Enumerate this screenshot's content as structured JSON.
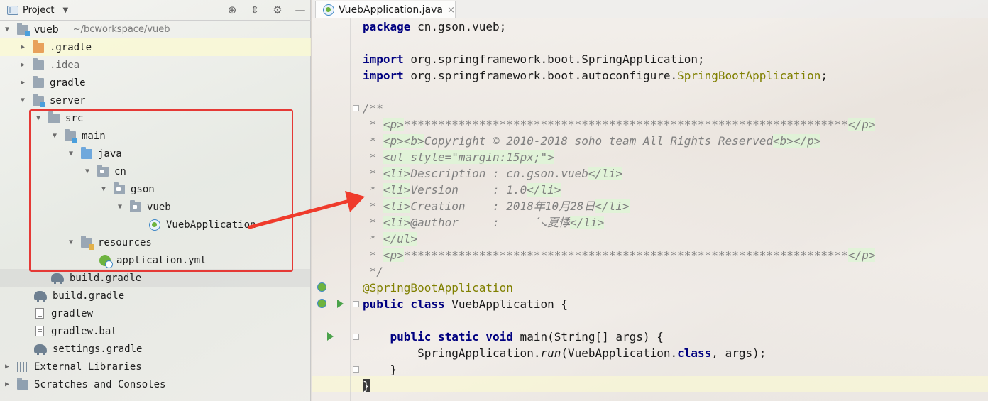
{
  "project_panel": {
    "title": "Project",
    "tools": [
      "target-icon",
      "collapse-icon",
      "gear-icon",
      "minimize-icon"
    ],
    "tree": [
      {
        "label": "vueb",
        "path": "~/bcworkspace/vueb"
      },
      {
        "label": ".gradle"
      },
      {
        "label": ".idea"
      },
      {
        "label": "gradle"
      },
      {
        "label": "server"
      },
      {
        "label": "src"
      },
      {
        "label": "main"
      },
      {
        "label": "java"
      },
      {
        "label": "cn"
      },
      {
        "label": "gson"
      },
      {
        "label": "vueb"
      },
      {
        "label": "VuebApplication"
      },
      {
        "label": "resources"
      },
      {
        "label": "application.yml"
      },
      {
        "label": "build.gradle"
      },
      {
        "label": "build.gradle"
      },
      {
        "label": "gradlew"
      },
      {
        "label": "gradlew.bat"
      },
      {
        "label": "settings.gradle"
      },
      {
        "label": "External Libraries"
      },
      {
        "label": "Scratches and Consoles"
      }
    ]
  },
  "editor": {
    "tab_label": "VuebApplication.java",
    "tab_close": "×",
    "code": {
      "l1_kw": "package",
      "l1_rest": " cn.gson.vueb;",
      "l3_kw": "import",
      "l3_rest": " org.springframework.boot.SpringApplication;",
      "l4_kw": "import",
      "l4_rest": " org.springframework.boot.autoconfigure.",
      "l4_ann": "SpringBootApplication",
      "l4_end": ";",
      "l6": "/**",
      "l7_pre": " * ",
      "l7_tag1": "<p>",
      "l7_mid": "*****************************************************************",
      "l7_tag2": "</p>",
      "l8_pre": " * ",
      "l8_tag1": "<p><b>",
      "l8_mid": "Copyright © 2010-2018 soho team All Rights Reserved",
      "l8_tag2": "<b></p>",
      "l9_pre": " * ",
      "l9_tag": "<ul style=\"margin:15px;\">",
      "l10_pre": " * ",
      "l10_tag1": "<li>",
      "l10_mid": "Description : cn.gson.vueb",
      "l10_tag2": "</li>",
      "l11_pre": " * ",
      "l11_tag1": "<li>",
      "l11_mid": "Version     : 1.0",
      "l11_tag2": "</li>",
      "l12_pre": " * ",
      "l12_tag1": "<li>",
      "l12_mid": "Creation    : 2018年10月28日",
      "l12_tag2": "</li>",
      "l13_pre": " * ",
      "l13_tag1": "<li>",
      "l13_mid": "@author     : ____´↘夏悸",
      "l13_tag2": "</li>",
      "l14_pre": " * ",
      "l14_tag": "</ul>",
      "l15_pre": " * ",
      "l15_tag1": "<p>",
      "l15_mid": "*****************************************************************",
      "l15_tag2": "</p>",
      "l16": " */",
      "l17": "@SpringBootApplication",
      "l18_kw": "public class",
      "l18_rest": " VuebApplication {",
      "l20_kw": "    public static void",
      "l20_rest": " main(String[] args) {",
      "l21_a": "        SpringApplication.",
      "l21_it": "run",
      "l21_b": "(VuebApplication.",
      "l21_kw": "class",
      "l21_c": ", args);",
      "l22": "    }",
      "l23": "}"
    }
  }
}
